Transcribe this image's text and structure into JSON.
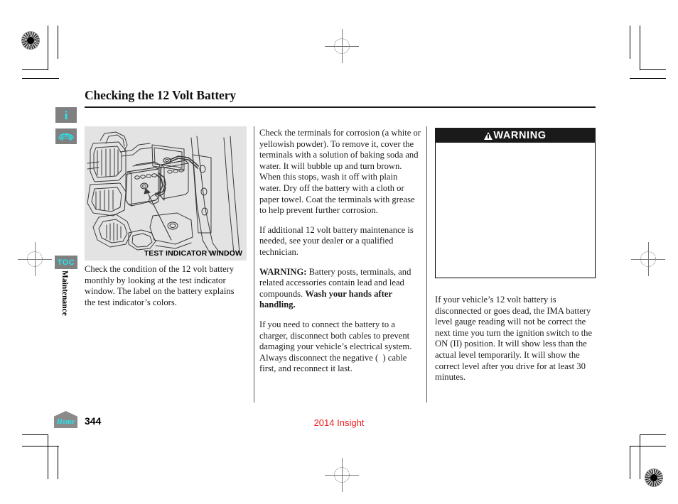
{
  "document": {
    "title": "Checking the 12 Volt Battery",
    "page_number": "344",
    "model_footer": "2014 Insight",
    "section_tab": "Maintenance"
  },
  "sidebar": {
    "info_icon_label": "i",
    "vehicle_icon_label": "vehicle-icon",
    "toc_label": "TOC",
    "home_label": "Home"
  },
  "figure": {
    "caption": "TEST INDICATOR WINDOW",
    "alt": "engine-bay-battery-illustration"
  },
  "left_column": {
    "paragraph_1": "Check the condition of the 12 volt battery monthly by looking at the test indicator window. The label on the battery explains the test indicator’s colors."
  },
  "middle_column": {
    "paragraph_1": "Check the terminals for corrosion (a white or yellowish powder). To remove it, cover the terminals with a solution of baking soda and water. It will bubble up and turn brown. When this stops, wash it off with plain water. Dry off the battery with a cloth or paper towel. Coat the terminals with grease to help prevent further corrosion.",
    "paragraph_2": "If additional 12 volt battery maintenance is needed, see your dealer or a qualified technician.",
    "paragraph_3_lead": "WARNING:",
    "paragraph_3_body": " Battery posts, terminals, and related accessories contain lead and lead compounds. ",
    "paragraph_3_bold_tail": "Wash your hands after handling.",
    "paragraph_4": "If you need to connect the battery to a charger, disconnect both cables to prevent damaging your vehicle’s electrical system. Always disconnect the negative (  ) cable first, and reconnect it last."
  },
  "right_column": {
    "warning_heading": "WARNING",
    "warning_body": "",
    "paragraph_1": "If your vehicle’s 12 volt battery is disconnected or goes dead, the IMA battery level gauge reading will not be correct the next time you turn the ignition switch to the ON (II) position. It will show less than the actual level temporarily. It will show the correct level after you drive for at least 30 minutes."
  },
  "colors": {
    "accent_cyan": "#24e6ee",
    "footer_red": "#ef1c1c",
    "button_gray": "#808080",
    "figure_bg": "#e3e3e3",
    "warning_bar": "#1a1a1a"
  }
}
